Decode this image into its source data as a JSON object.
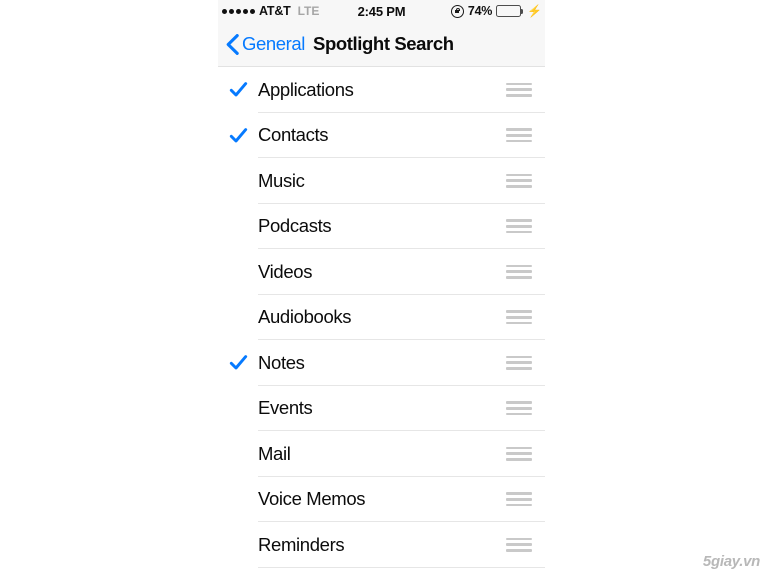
{
  "status_bar": {
    "signal_dots": 5,
    "carrier": "AT&T",
    "network": "LTE",
    "time": "2:45 PM",
    "battery_percent": "74%",
    "battery_level": 74,
    "rotation_lock_icon": "rotation-lock-icon",
    "charging_icon": "lightning-bolt-icon",
    "battery_color": "#31d158"
  },
  "nav_bar": {
    "back_icon": "chevron-left-icon",
    "back_label": "General",
    "title": "Spotlight Search",
    "accent_color": "#067aff",
    "background_color": "#f7f7f7"
  },
  "list": {
    "checkmark_icon": "checkmark-icon",
    "reorder_icon": "reorder-handle-icon",
    "checkmark_color": "#067aff",
    "rows": [
      {
        "label": "Applications",
        "checked": true
      },
      {
        "label": "Contacts",
        "checked": true
      },
      {
        "label": "Music",
        "checked": false
      },
      {
        "label": "Podcasts",
        "checked": false
      },
      {
        "label": "Videos",
        "checked": false
      },
      {
        "label": "Audiobooks",
        "checked": false
      },
      {
        "label": "Notes",
        "checked": true
      },
      {
        "label": "Events",
        "checked": false
      },
      {
        "label": "Mail",
        "checked": false
      },
      {
        "label": "Voice Memos",
        "checked": false
      },
      {
        "label": "Reminders",
        "checked": false
      }
    ]
  },
  "watermark": {
    "text": "5giay.vn"
  }
}
